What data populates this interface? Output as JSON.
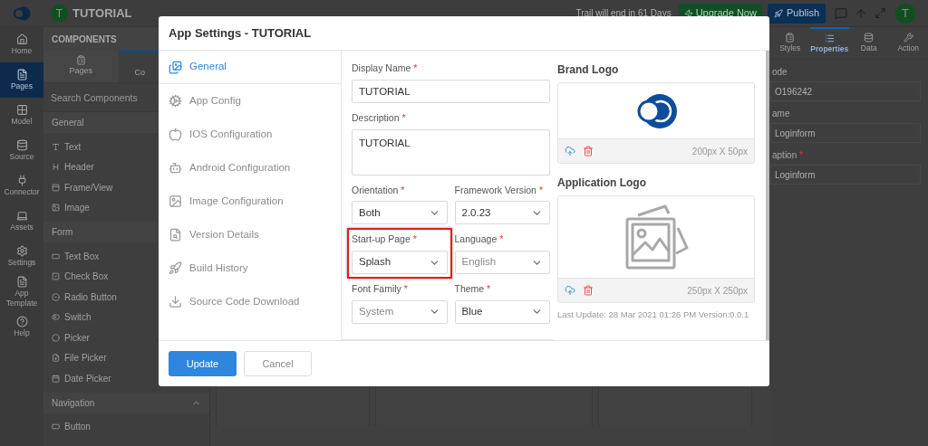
{
  "top_bar": {
    "app_initial": "T",
    "app_name": "TUTORIAL",
    "trial_notice": "Trail will end in 61 Days",
    "upgrade_button": "Upgrade Now",
    "publish_button": "Publish",
    "user_initial": "T"
  },
  "nav_rail": [
    {
      "label": "Home",
      "selected": false
    },
    {
      "label": "Pages",
      "selected": true
    },
    {
      "label": "Model",
      "selected": false
    },
    {
      "label": "Source",
      "selected": false
    },
    {
      "label": "Connector",
      "selected": false
    },
    {
      "label": "Assets",
      "selected": false
    },
    {
      "label": "Settings",
      "selected": false
    },
    {
      "label": "App Template",
      "selected": false
    },
    {
      "label": "Help",
      "selected": false
    }
  ],
  "components_panel": {
    "title": "COMPONENTS",
    "tabs": [
      {
        "label": "Pages",
        "selected": false
      },
      {
        "label": "Co",
        "selected": true
      }
    ],
    "search": {
      "placeholder": "Search Components"
    },
    "sections": [
      {
        "title": "General",
        "items": [
          "Text",
          "Header",
          "Frame/View",
          "Image"
        ]
      },
      {
        "title": "Form",
        "items": [
          "Text Box",
          "Check Box",
          "Radio Button",
          "Switch",
          "Picker",
          "File Picker",
          "Date Picker"
        ]
      },
      {
        "title": "Navigation",
        "expanded": true,
        "items": [
          "Button"
        ]
      }
    ]
  },
  "properties_panel": {
    "tabs": [
      {
        "label": "Styles",
        "selected": false
      },
      {
        "label": "Properties",
        "selected": true
      },
      {
        "label": "Data",
        "selected": false
      },
      {
        "label": "Action",
        "selected": false
      }
    ],
    "fields": [
      {
        "label": "ode",
        "value": "O196242"
      },
      {
        "label": "ame",
        "value": "Loginform"
      },
      {
        "label": "aption",
        "required_mark": "*",
        "value": "Loginform"
      }
    ]
  },
  "dialog": {
    "title": "App Settings - TUTORIAL",
    "nav": [
      {
        "label": "General",
        "selected": true
      },
      {
        "label": "App Config",
        "selected": false
      },
      {
        "label": "IOS Configuration",
        "selected": false
      },
      {
        "label": "Android Configuration",
        "selected": false
      },
      {
        "label": "Image Configuration",
        "selected": false
      },
      {
        "label": "Version Details",
        "selected": false
      },
      {
        "label": "Build History",
        "selected": false
      },
      {
        "label": "Source Code Download",
        "selected": false
      }
    ],
    "display_name": {
      "label": "Display Name",
      "required_mark": "*",
      "value": "TUTORIAL"
    },
    "description": {
      "label": "Description",
      "required_mark": "*",
      "value": "TUTORIAL"
    },
    "selects": [
      {
        "label": "Orientation",
        "required_mark": "*",
        "value": "Both",
        "disabled": false,
        "highlighted": false
      },
      {
        "label": "Framework Version",
        "required_mark": "*",
        "value": "2.0.23",
        "disabled": false,
        "highlighted": false
      },
      {
        "label": "Start-up Page",
        "required_mark": "*",
        "value": "Splash",
        "disabled": false,
        "highlighted": true
      },
      {
        "label": "Language",
        "required_mark": "*",
        "value": "English",
        "disabled": true,
        "highlighted": false
      },
      {
        "label": "Font Family",
        "required_mark": "*",
        "value": "System",
        "disabled": true,
        "highlighted": false
      },
      {
        "label": "Theme",
        "required_mark": "*",
        "value": "Blue",
        "disabled": false,
        "highlighted": false
      }
    ],
    "brand_logo": {
      "title": "Brand Logo",
      "size": "200px X 50px"
    },
    "application_logo": {
      "title": "Application Logo",
      "size": "250px X 250px"
    },
    "last_update": "Last Update: 28 Mar 2021 01:26 PM Version:0.0.1",
    "buttons": {
      "primary": "Update",
      "secondary": "Cancel"
    }
  }
}
